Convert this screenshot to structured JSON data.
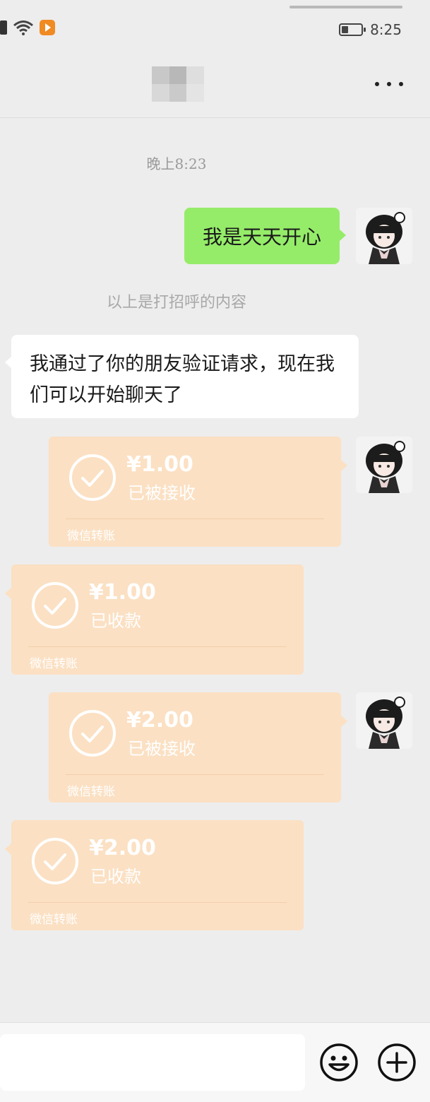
{
  "status_bar": {
    "time": "8:25"
  },
  "nav": {
    "more_label": "更多"
  },
  "chat": {
    "timestamp": "晚上8:23",
    "messages": [
      {
        "type": "text",
        "side": "sent",
        "text": "我是天天开心"
      },
      {
        "type": "system",
        "text": "以上是打招呼的内容"
      },
      {
        "type": "text",
        "side": "received",
        "text": "我通过了你的朋友验证请求，现在我们可以开始聊天了"
      },
      {
        "type": "transfer",
        "side": "sent",
        "amount": "¥1.00",
        "status": "已被接收",
        "footer": "微信转账"
      },
      {
        "type": "transfer",
        "side": "received",
        "amount": "¥1.00",
        "status": "已收款",
        "footer": "微信转账"
      },
      {
        "type": "transfer",
        "side": "sent",
        "amount": "¥2.00",
        "status": "已被接收",
        "footer": "微信转账"
      },
      {
        "type": "transfer",
        "side": "received",
        "amount": "¥2.00",
        "status": "已收款",
        "footer": "微信转账"
      }
    ]
  },
  "input_bar": {
    "value": "",
    "icons": [
      "emoji-icon",
      "plus-icon"
    ]
  },
  "colors": {
    "background": "#ededed",
    "sent_bubble": "#95ec69",
    "received_bubble": "#ffffff",
    "transfer_card": "#fbe0c3",
    "system_text": "#a8a8a8"
  }
}
